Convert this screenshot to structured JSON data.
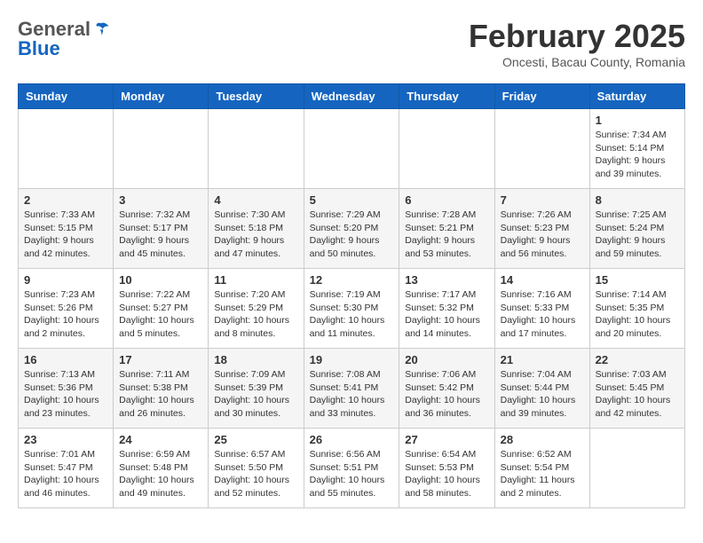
{
  "header": {
    "logo_general": "General",
    "logo_blue": "Blue",
    "month_title": "February 2025",
    "location": "Oncesti, Bacau County, Romania"
  },
  "calendar": {
    "columns": [
      "Sunday",
      "Monday",
      "Tuesday",
      "Wednesday",
      "Thursday",
      "Friday",
      "Saturday"
    ],
    "weeks": [
      [
        {
          "day": "",
          "info": ""
        },
        {
          "day": "",
          "info": ""
        },
        {
          "day": "",
          "info": ""
        },
        {
          "day": "",
          "info": ""
        },
        {
          "day": "",
          "info": ""
        },
        {
          "day": "",
          "info": ""
        },
        {
          "day": "1",
          "info": "Sunrise: 7:34 AM\nSunset: 5:14 PM\nDaylight: 9 hours and 39 minutes."
        }
      ],
      [
        {
          "day": "2",
          "info": "Sunrise: 7:33 AM\nSunset: 5:15 PM\nDaylight: 9 hours and 42 minutes."
        },
        {
          "day": "3",
          "info": "Sunrise: 7:32 AM\nSunset: 5:17 PM\nDaylight: 9 hours and 45 minutes."
        },
        {
          "day": "4",
          "info": "Sunrise: 7:30 AM\nSunset: 5:18 PM\nDaylight: 9 hours and 47 minutes."
        },
        {
          "day": "5",
          "info": "Sunrise: 7:29 AM\nSunset: 5:20 PM\nDaylight: 9 hours and 50 minutes."
        },
        {
          "day": "6",
          "info": "Sunrise: 7:28 AM\nSunset: 5:21 PM\nDaylight: 9 hours and 53 minutes."
        },
        {
          "day": "7",
          "info": "Sunrise: 7:26 AM\nSunset: 5:23 PM\nDaylight: 9 hours and 56 minutes."
        },
        {
          "day": "8",
          "info": "Sunrise: 7:25 AM\nSunset: 5:24 PM\nDaylight: 9 hours and 59 minutes."
        }
      ],
      [
        {
          "day": "9",
          "info": "Sunrise: 7:23 AM\nSunset: 5:26 PM\nDaylight: 10 hours and 2 minutes."
        },
        {
          "day": "10",
          "info": "Sunrise: 7:22 AM\nSunset: 5:27 PM\nDaylight: 10 hours and 5 minutes."
        },
        {
          "day": "11",
          "info": "Sunrise: 7:20 AM\nSunset: 5:29 PM\nDaylight: 10 hours and 8 minutes."
        },
        {
          "day": "12",
          "info": "Sunrise: 7:19 AM\nSunset: 5:30 PM\nDaylight: 10 hours and 11 minutes."
        },
        {
          "day": "13",
          "info": "Sunrise: 7:17 AM\nSunset: 5:32 PM\nDaylight: 10 hours and 14 minutes."
        },
        {
          "day": "14",
          "info": "Sunrise: 7:16 AM\nSunset: 5:33 PM\nDaylight: 10 hours and 17 minutes."
        },
        {
          "day": "15",
          "info": "Sunrise: 7:14 AM\nSunset: 5:35 PM\nDaylight: 10 hours and 20 minutes."
        }
      ],
      [
        {
          "day": "16",
          "info": "Sunrise: 7:13 AM\nSunset: 5:36 PM\nDaylight: 10 hours and 23 minutes."
        },
        {
          "day": "17",
          "info": "Sunrise: 7:11 AM\nSunset: 5:38 PM\nDaylight: 10 hours and 26 minutes."
        },
        {
          "day": "18",
          "info": "Sunrise: 7:09 AM\nSunset: 5:39 PM\nDaylight: 10 hours and 30 minutes."
        },
        {
          "day": "19",
          "info": "Sunrise: 7:08 AM\nSunset: 5:41 PM\nDaylight: 10 hours and 33 minutes."
        },
        {
          "day": "20",
          "info": "Sunrise: 7:06 AM\nSunset: 5:42 PM\nDaylight: 10 hours and 36 minutes."
        },
        {
          "day": "21",
          "info": "Sunrise: 7:04 AM\nSunset: 5:44 PM\nDaylight: 10 hours and 39 minutes."
        },
        {
          "day": "22",
          "info": "Sunrise: 7:03 AM\nSunset: 5:45 PM\nDaylight: 10 hours and 42 minutes."
        }
      ],
      [
        {
          "day": "23",
          "info": "Sunrise: 7:01 AM\nSunset: 5:47 PM\nDaylight: 10 hours and 46 minutes."
        },
        {
          "day": "24",
          "info": "Sunrise: 6:59 AM\nSunset: 5:48 PM\nDaylight: 10 hours and 49 minutes."
        },
        {
          "day": "25",
          "info": "Sunrise: 6:57 AM\nSunset: 5:50 PM\nDaylight: 10 hours and 52 minutes."
        },
        {
          "day": "26",
          "info": "Sunrise: 6:56 AM\nSunset: 5:51 PM\nDaylight: 10 hours and 55 minutes."
        },
        {
          "day": "27",
          "info": "Sunrise: 6:54 AM\nSunset: 5:53 PM\nDaylight: 10 hours and 58 minutes."
        },
        {
          "day": "28",
          "info": "Sunrise: 6:52 AM\nSunset: 5:54 PM\nDaylight: 11 hours and 2 minutes."
        },
        {
          "day": "",
          "info": ""
        }
      ]
    ]
  }
}
